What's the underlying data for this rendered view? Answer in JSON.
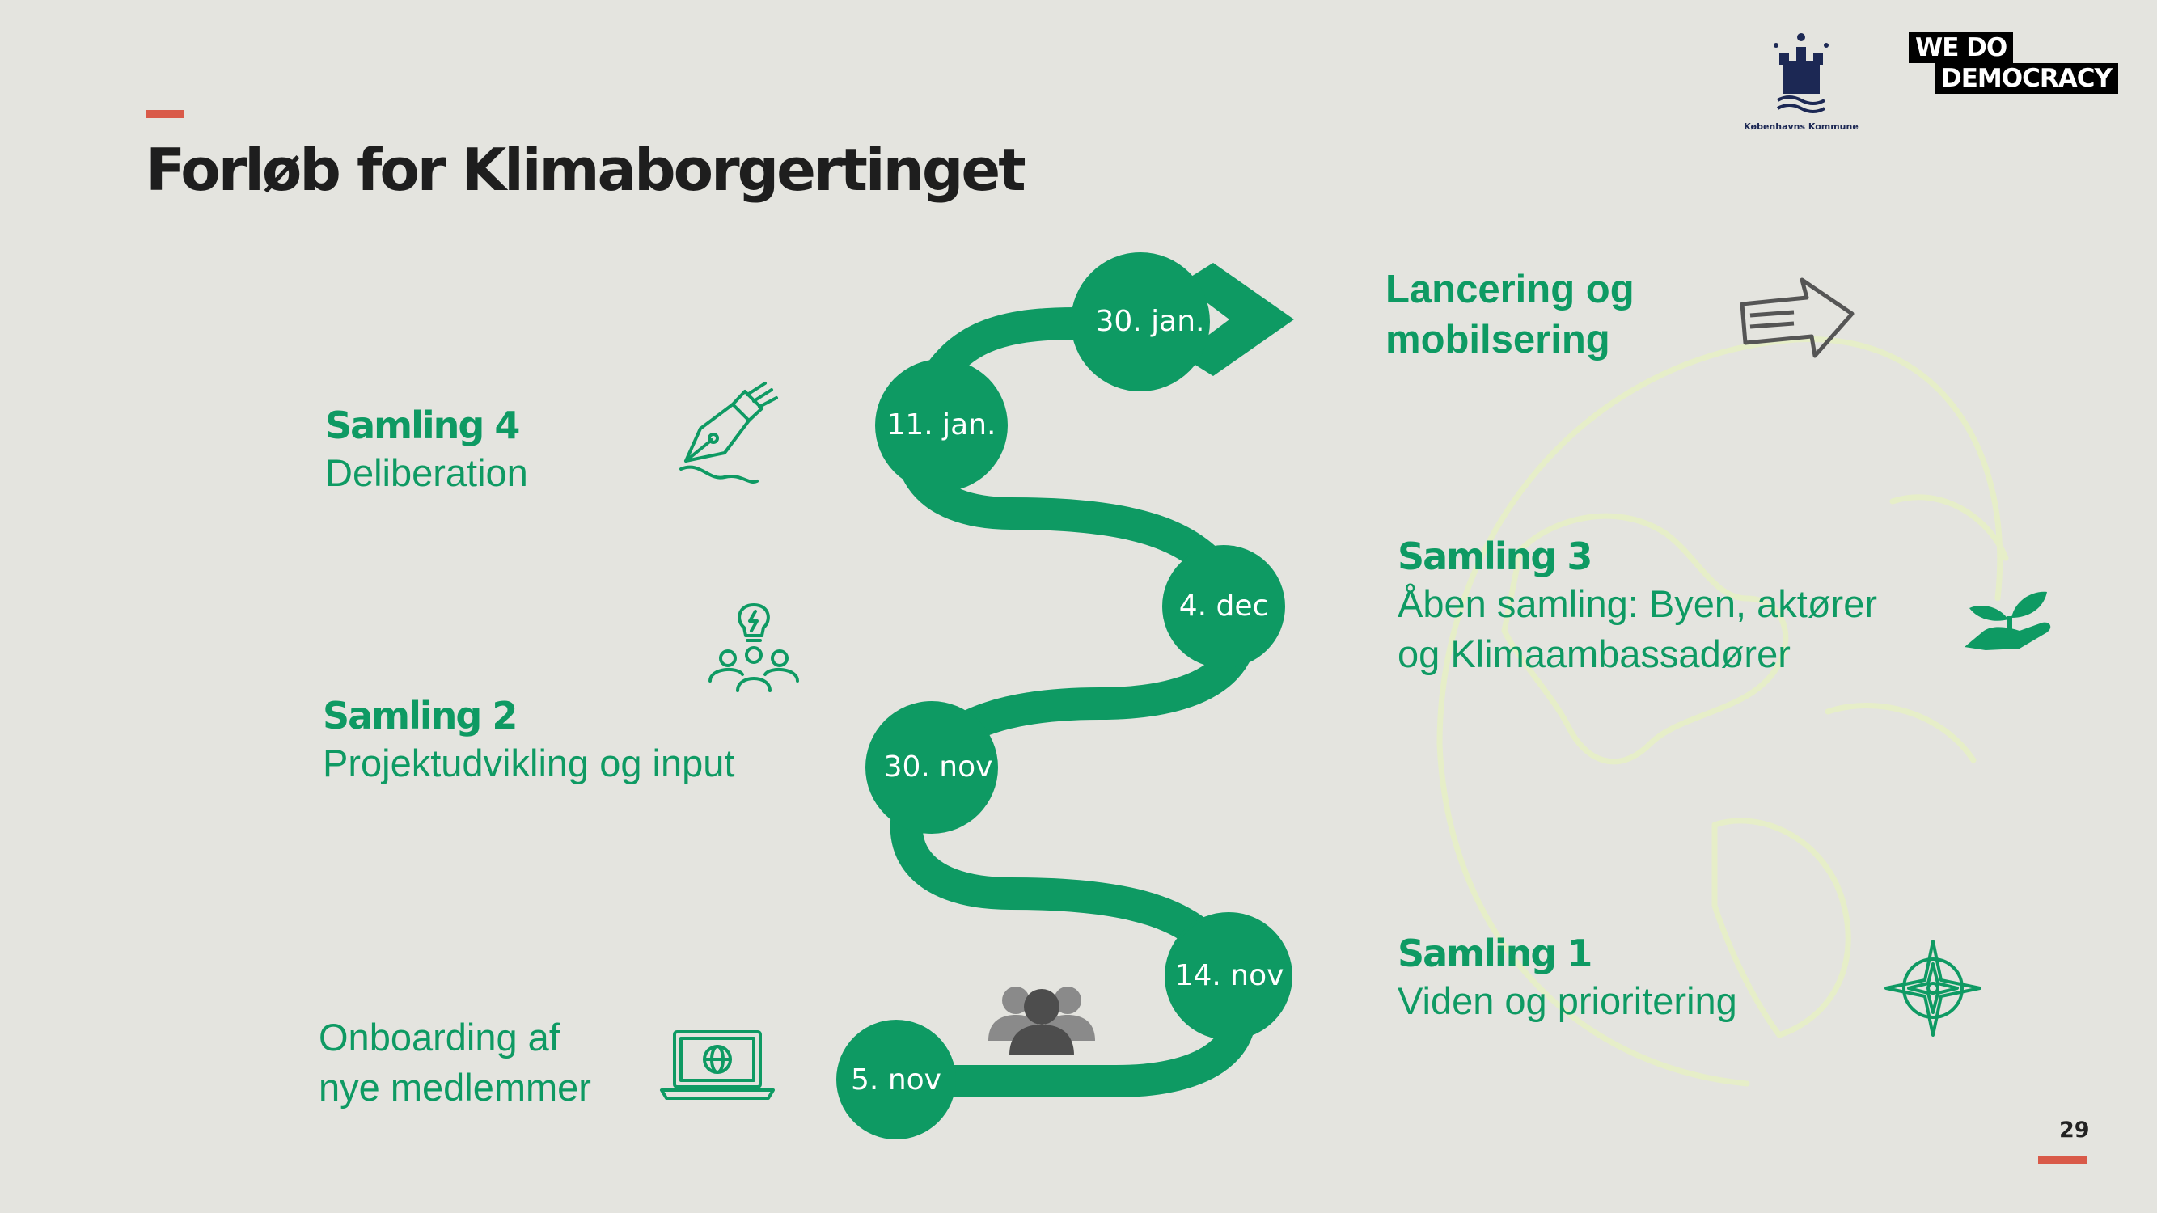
{
  "header": {
    "title": "Forløb for Klimaborgertinget",
    "logos": {
      "kommune_name": "Københavns Kommune",
      "wdd_line1": "WE DO",
      "wdd_line2": "DEMOCRACY"
    }
  },
  "timeline": {
    "nodes": [
      {
        "label": "5. nov"
      },
      {
        "label": "14. nov"
      },
      {
        "label": "30. nov"
      },
      {
        "label": "4. dec"
      },
      {
        "label": "11. jan."
      },
      {
        "label": "30. jan."
      }
    ]
  },
  "items": {
    "onboarding": {
      "text_line1": "Onboarding af",
      "text_line2": "nye medlemmer",
      "icon": "laptop-globe-icon"
    },
    "samling1": {
      "head": "Samling 1",
      "body": "Viden og prioritering",
      "icon": "compass-icon"
    },
    "samling2": {
      "head": "Samling 2",
      "body": "Projektudvikling og input",
      "icon": "team-idea-icon"
    },
    "samling3": {
      "head": "Samling 3",
      "body_line1": "Åben samling: Byen, aktører",
      "body_line2": "og Klimaambassadører",
      "icon": "plant-hand-icon"
    },
    "samling4": {
      "head": "Samling 4",
      "body": "Deliberation",
      "icon": "pen-icon"
    },
    "launch": {
      "line1": "Lancering og",
      "line2": "mobilsering",
      "icon": "arrow-right-icon"
    }
  },
  "people_icon": "people-group-icon",
  "page_number": "29",
  "colors": {
    "green": "#0e9a63",
    "accent": "#d95a49",
    "background": "#e4e4df"
  }
}
